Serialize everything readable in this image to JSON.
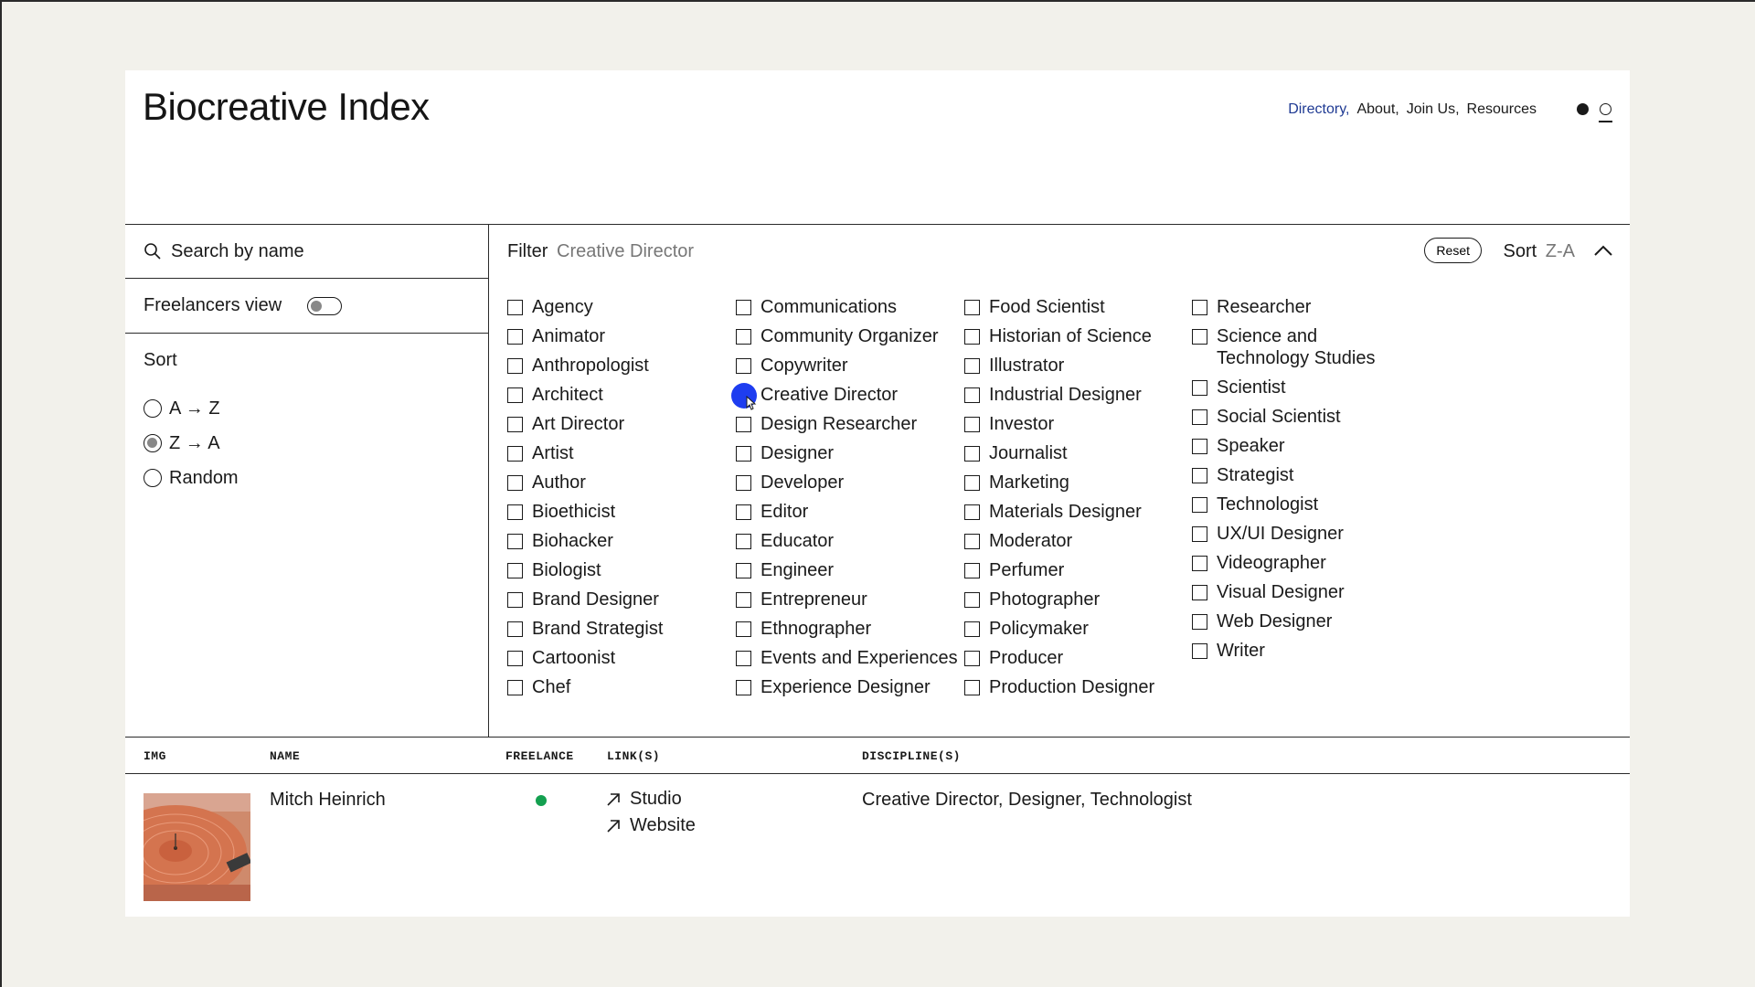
{
  "header": {
    "logo": "Biocreative Index",
    "nav": [
      {
        "label": "Directory,",
        "active": true
      },
      {
        "label": "About,",
        "active": false
      },
      {
        "label": "Join Us,",
        "active": false
      },
      {
        "label": "Resources",
        "active": false
      }
    ]
  },
  "sidebar": {
    "search_placeholder": "Search by name",
    "freelancers_label": "Freelancers view",
    "sort_title": "Sort",
    "sort_options": [
      {
        "label": "A → Z",
        "checked": false
      },
      {
        "label": "Z → A",
        "checked": true
      },
      {
        "label": "Random",
        "checked": false
      }
    ]
  },
  "filter": {
    "label": "Filter",
    "active_value": "Creative Director",
    "reset_label": "Reset",
    "sort_label": "Sort",
    "sort_value": "Z-A",
    "columns": [
      [
        "Agency",
        "Animator",
        "Anthropologist",
        "Architect",
        "Art Director",
        "Artist",
        "Author",
        "Bioethicist",
        "Biohacker",
        "Biologist",
        "Brand Designer",
        "Brand Strategist",
        "Cartoonist",
        "Chef"
      ],
      [
        "Communications",
        "Community Organizer",
        "Copywriter",
        "Creative Director",
        "Design Researcher",
        "Designer",
        "Developer",
        "Editor",
        "Educator",
        "Engineer",
        "Entrepreneur",
        "Ethnographer",
        "Events and Experiences",
        "Experience Designer"
      ],
      [
        "Food Scientist",
        "Historian of Science",
        "Illustrator",
        "Industrial Designer",
        "Investor",
        "Journalist",
        "Marketing",
        "Materials Designer",
        "Moderator",
        "Perfumer",
        "Photographer",
        "Policymaker",
        "Producer",
        "Production Designer"
      ],
      [
        "Researcher",
        "Science and Technology Studies",
        "Scientist",
        "Social Scientist",
        "Speaker",
        "Strategist",
        "Technologist",
        "UX/UI Designer",
        "Videographer",
        "Visual Designer",
        "Web Designer",
        "Writer"
      ]
    ],
    "hovered": "Creative Director"
  },
  "table": {
    "headers": {
      "img": "IMG",
      "name": "NAME",
      "freelance": "FREELANCE",
      "links": "LINK(S)",
      "disciplines": "DISCIPLINE(S)"
    },
    "rows": [
      {
        "name": "Mitch Heinrich",
        "freelance": true,
        "links": [
          "Studio",
          "Website"
        ],
        "disciplines": "Creative Director, Designer, Technologist"
      }
    ]
  },
  "colors": {
    "accent_blue": "#1e3df0",
    "nav_active": "#1f3a93",
    "freelance_green": "#14a050",
    "page_bg": "#f2f1eb"
  }
}
